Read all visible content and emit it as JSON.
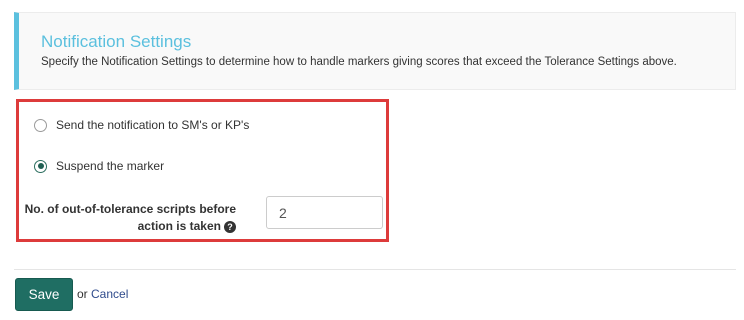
{
  "notification": {
    "title": "Notification Settings",
    "description": "Specify the Notification Settings to determine how to handle markers giving scores that exceed the Tolerance Settings above.",
    "accent_color": "#5bc0de"
  },
  "options": {
    "notify_label": "Send the notification to SM's or KP's",
    "notify_selected": false,
    "suspend_label": "Suspend the marker",
    "suspend_selected": true
  },
  "threshold": {
    "label_line1": "No. of out-of-tolerance scripts before",
    "label_line2": "action is taken",
    "help_glyph": "?",
    "value": "2"
  },
  "actions": {
    "save_label": "Save",
    "or_text": "or",
    "cancel_label": "Cancel",
    "save_color": "#1f6e63"
  },
  "highlight_color": "#dd3b3b"
}
